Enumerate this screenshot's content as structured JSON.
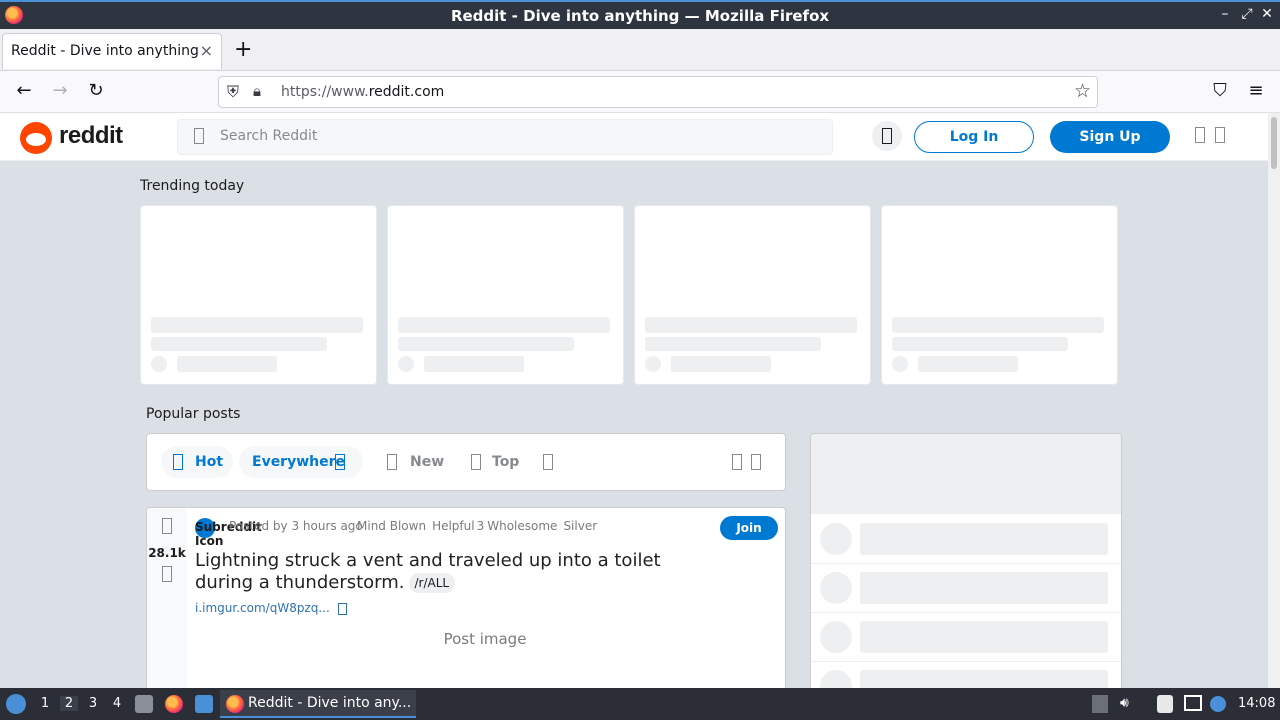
{
  "window": {
    "title": "Reddit - Dive into anything — Mozilla Firefox",
    "minimize_icon": "minimize-icon",
    "maximize_icon": "maximize-icon",
    "close_icon": "close-icon"
  },
  "tabs": [
    {
      "label": "Reddit - Dive into anything",
      "close": "×"
    }
  ],
  "newtab": "+",
  "nav": {
    "back": "←",
    "forward": "→",
    "reload": "↻",
    "url_prefix": "https://www.",
    "url_domain": "reddit.com",
    "bookmark": "☆",
    "pocket": "⛉",
    "menu": "≡"
  },
  "reddit": {
    "wordmark": "reddit",
    "search_placeholder": "Search Reddit",
    "login": "Log In",
    "signup": "Sign Up"
  },
  "trending": {
    "title": "Trending today"
  },
  "popular": {
    "title": "Popular posts",
    "sort": [
      "Hot",
      "Everywhere",
      "New",
      "Top"
    ]
  },
  "post": {
    "votes": "28.1k",
    "subreddit_alt": "Subreddit Icon",
    "posted_by": "Posted by 3 hours ago",
    "awards": [
      "Mind Blown",
      "Helpful",
      "3",
      "Wholesome",
      "Silver"
    ],
    "join": "Join",
    "title": "Lightning struck a vent and traveled up into a toilet during a thunderstorm.",
    "flair": "/r/ALL",
    "link": "i.imgur.com/qW8pzq...",
    "image_alt": "Post image"
  },
  "taskbar": {
    "workspaces": [
      "1",
      "2",
      "3",
      "4"
    ],
    "active_workspace": "2",
    "window_label": "Reddit - Dive into any...",
    "clock": "14:08"
  },
  "colors": {
    "accent": "#0079d3",
    "brand": "#ff4500",
    "page_bg": "#dae0e6"
  }
}
